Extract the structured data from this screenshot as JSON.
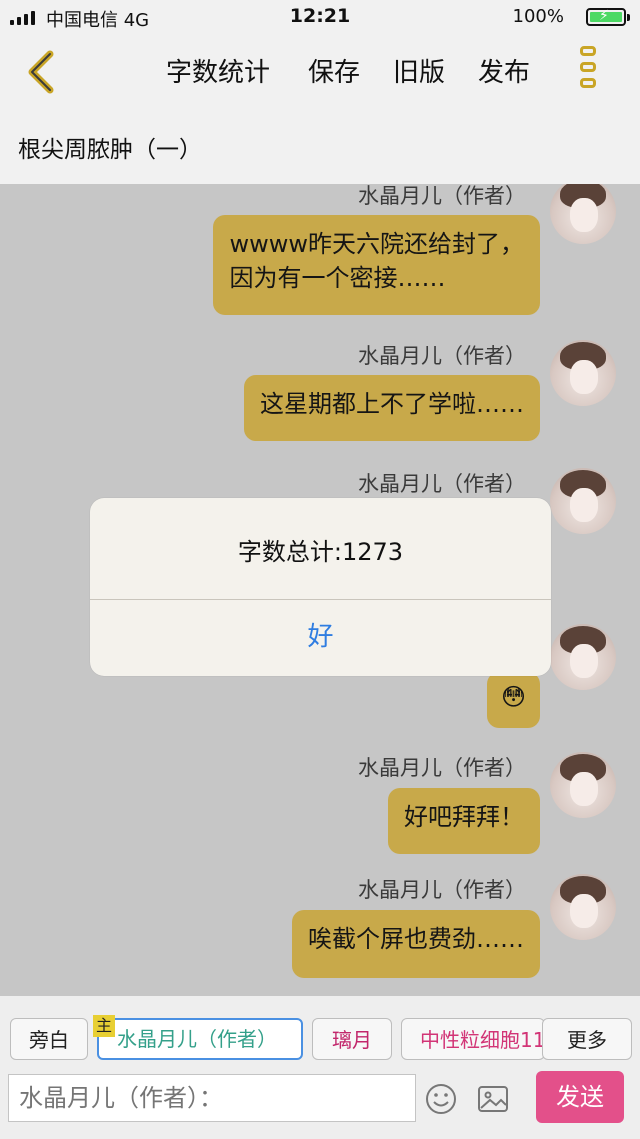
{
  "status": {
    "carrier": "中国电信   4G",
    "time": "12:21",
    "battery": "100%"
  },
  "nav": {
    "stats": "字数统计",
    "save": "保存",
    "old": "旧版",
    "publish": "发布"
  },
  "title": "根尖周脓肿（一）",
  "messages": [
    {
      "name": "水晶月儿（作者）",
      "lines": [
        "wwww昨天六院还给封了，",
        "因为有一个密接……"
      ]
    },
    {
      "name": "水晶月儿（作者）",
      "lines": [
        "这星期都上不了学啦……"
      ]
    },
    {
      "name": "水晶月儿（作者）",
      "lines": []
    },
    {
      "name": "",
      "lines": [
        "😳"
      ]
    },
    {
      "name": "水晶月儿（作者）",
      "lines": [
        "好吧拜拜！"
      ]
    },
    {
      "name": "水晶月儿（作者）",
      "lines": [
        "唉截个屏也费劲……"
      ]
    }
  ],
  "alert": {
    "message": "字数总计:1273",
    "ok": "好"
  },
  "roles": {
    "narration": "旁白",
    "main_badge": "主",
    "author": "水晶月儿（作者）",
    "liyue": "璃月",
    "neutrophil": "中性粒细胞11",
    "more": "更多"
  },
  "input": {
    "placeholder": "水晶月儿（作者）：",
    "send": "发送"
  },
  "colors": {
    "bubble": "#c8a94a",
    "accent": "#c9a526",
    "send": "#e3508a",
    "ok": "#2f7de1"
  }
}
